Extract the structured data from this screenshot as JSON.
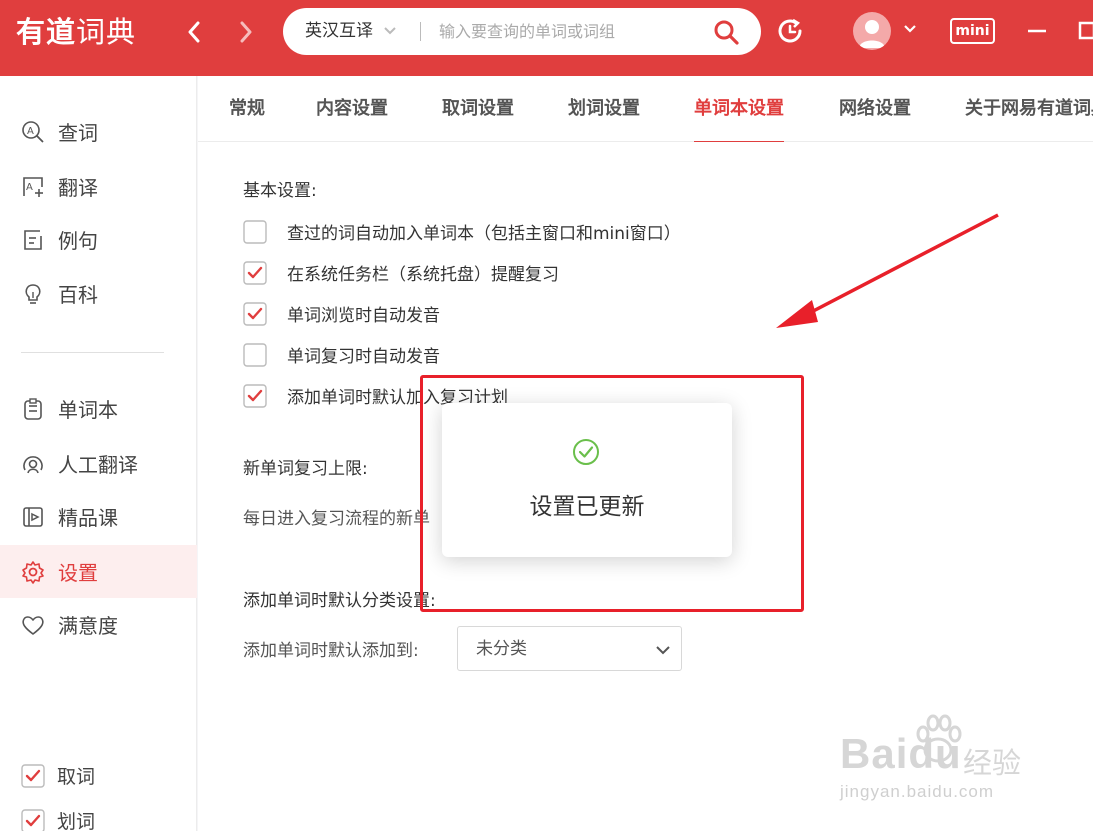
{
  "app": {
    "logo_main": "有道",
    "logo_sub": "词典",
    "mini_label": "mini"
  },
  "search": {
    "lang": "英汉互译",
    "placeholder": "输入要查询的单词或词组",
    "value": ""
  },
  "sidebar": {
    "items": [
      {
        "label": "查词",
        "icon": "search-word-icon"
      },
      {
        "label": "翻译",
        "icon": "translate-icon"
      },
      {
        "label": "例句",
        "icon": "example-icon"
      },
      {
        "label": "百科",
        "icon": "bulb-icon"
      },
      {
        "label": "单词本",
        "icon": "wordbook-icon"
      },
      {
        "label": "人工翻译",
        "icon": "human-translate-icon"
      },
      {
        "label": "精品课",
        "icon": "course-icon"
      },
      {
        "label": "设置",
        "icon": "gear-icon",
        "active": true
      },
      {
        "label": "满意度",
        "icon": "heart-icon"
      }
    ],
    "toggles": [
      {
        "label": "取词",
        "checked": true
      },
      {
        "label": "划词",
        "checked": true
      }
    ]
  },
  "tabs": [
    {
      "label": "常规"
    },
    {
      "label": "内容设置"
    },
    {
      "label": "取词设置"
    },
    {
      "label": "划词设置"
    },
    {
      "label": "单词本设置",
      "active": true
    },
    {
      "label": "网络设置"
    },
    {
      "label": "关于网易有道词典"
    }
  ],
  "settings": {
    "basic_title": "基本设置:",
    "options": [
      {
        "label": "查过的词自动加入单词本（包括主窗口和mini窗口）",
        "checked": false
      },
      {
        "label": "在系统任务栏（系统托盘）提醒复习",
        "checked": true
      },
      {
        "label": "单词浏览时自动发音",
        "checked": true
      },
      {
        "label": "单词复习时自动发音",
        "checked": false
      },
      {
        "label": "添加单词时默认加入复习计划",
        "checked": true
      }
    ],
    "review_title": "新单词复习上限:",
    "review_desc": "每日进入复习流程的新单",
    "category_title": "添加单词时默认分类设置:",
    "category_label": "添加单词时默认添加到:",
    "category_value": "未分类"
  },
  "toast": {
    "message": "设置已更新"
  },
  "watermark": {
    "brand": "Baidu",
    "cn": "经验",
    "url": "jingyan.baidu.com"
  },
  "colors": {
    "brand_red": "#e03e3e",
    "active_bg": "#fdeeee",
    "success_green": "#6abf4b",
    "annotation_red": "#e8202a"
  }
}
